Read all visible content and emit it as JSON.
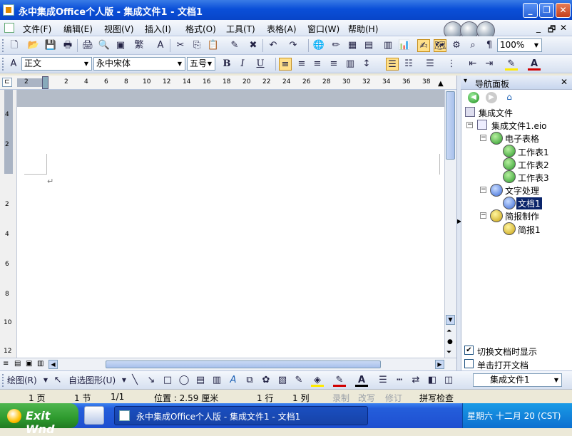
{
  "window": {
    "title": "永中集成Office个人版 - 集成文件1 - 文档1",
    "minimize_glyph": "_",
    "restore_glyph": "❐",
    "close_glyph": "✕"
  },
  "menubar": {
    "items": [
      {
        "label": "文件(F)"
      },
      {
        "label": "编辑(E)"
      },
      {
        "label": "视图(V)"
      },
      {
        "label": "插入(I)"
      },
      {
        "label": "格式(O)"
      },
      {
        "label": "工具(T)"
      },
      {
        "label": "表格(A)"
      },
      {
        "label": "窗口(W)"
      },
      {
        "label": "帮助(H)"
      }
    ],
    "mdi_controls": [
      "_",
      "🗗",
      "✕"
    ]
  },
  "standard_toolbar": {
    "zoom": "100%"
  },
  "format_toolbar": {
    "style": "正文",
    "font": "永中宋体",
    "size": "五号",
    "bold": "B",
    "italic": "I",
    "underline": "U"
  },
  "ruler": {
    "numbers": [
      "2",
      "2",
      "4",
      "6",
      "8",
      "10",
      "12",
      "14",
      "16",
      "18",
      "20",
      "22",
      "24",
      "26",
      "28",
      "30",
      "32",
      "34",
      "36",
      "38"
    ],
    "left_numbers": [
      "4",
      "2",
      "2",
      "4",
      "6",
      "8",
      "10",
      "12"
    ]
  },
  "document": {
    "paragraph_mark": "↵"
  },
  "nav_panel": {
    "title": "导航面板",
    "close": "✕",
    "tree": {
      "root": "集成文件",
      "file": "集成文件1.eio",
      "groups": [
        {
          "label": "电子表格",
          "color": "green",
          "children": [
            "工作表1",
            "工作表2",
            "工作表3"
          ]
        },
        {
          "label": "文字处理",
          "color": "blue",
          "children": [
            "文档1"
          ]
        },
        {
          "label": "简报制作",
          "color": "yellow",
          "children": [
            "简报1"
          ]
        }
      ],
      "selected": "文档1"
    },
    "options": [
      {
        "label": "切换文档时显示",
        "checked": true
      },
      {
        "label": "单击打开文档",
        "checked": false
      }
    ],
    "file_select": "集成文件1"
  },
  "draw_toolbar": {
    "draw_label": "绘图(R)",
    "autoshape_label": "自选图形(U)"
  },
  "statusbar": {
    "page": "1 页",
    "section": "1 节",
    "pages": "1/1",
    "position": "位置 : 2.59 厘米",
    "line": "1 行",
    "column": "1 列",
    "record": "录制",
    "overwrite": "改写",
    "revise": "修订",
    "spellcheck": "拼写检查"
  },
  "taskbar": {
    "start_label": "Exit Wnd",
    "task_title": "永中集成Office个人版 - 集成文件1 - 文档1",
    "clock": "星期六 十二月 20 (CST)"
  },
  "colors": {
    "titlebar": "#0a4fd8",
    "selection": "#0a246a",
    "taskbar": "#245edb",
    "start": "#2e9a2e"
  }
}
